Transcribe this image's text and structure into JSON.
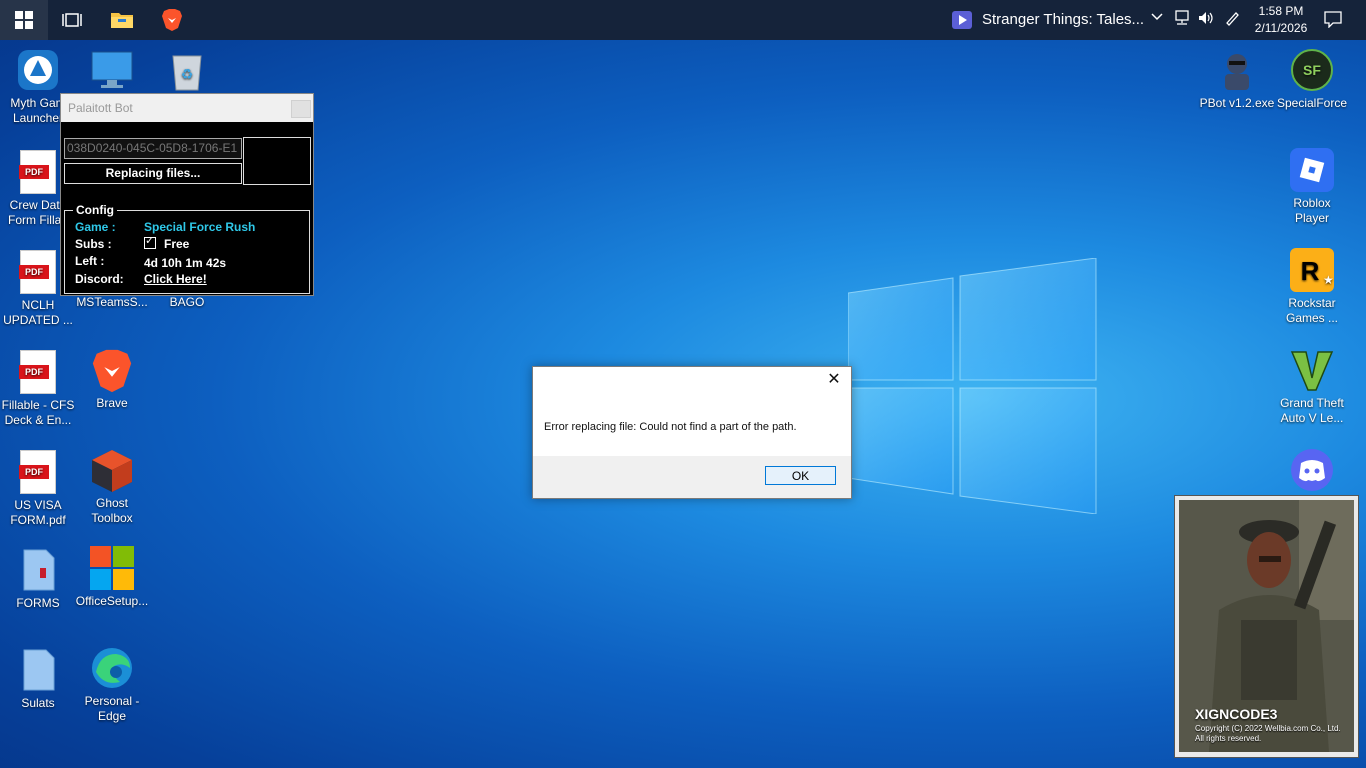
{
  "taskbar": {
    "media_title": "Stranger Things: Tales...",
    "time": "1:58 PM",
    "date": "2/11/2026",
    "icons": [
      "start-icon",
      "task-view-icon",
      "file-explorer-icon",
      "brave-icon"
    ]
  },
  "desktop_left": [
    {
      "label": "Myth Gam\nLauncher",
      "icon": "myth-launcher-icon"
    },
    {
      "label": "",
      "icon": "this-pc-icon"
    },
    {
      "label": "",
      "icon": "recycle-bin-icon"
    },
    {
      "label": "Crew Data\nForm Fillab",
      "icon": "pdf-icon"
    },
    {
      "label": "NCLH\nUPDATED ...",
      "icon": "pdf-icon"
    },
    {
      "label": "MSTeamsS...",
      "icon": "msteams-icon"
    },
    {
      "label": "BAGO",
      "icon": "folder-icon"
    },
    {
      "label": "Fillable - CFS\nDeck & En...",
      "icon": "pdf-icon"
    },
    {
      "label": "Brave",
      "icon": "brave-icon"
    },
    {
      "label": "US VISA\nFORM.pdf",
      "icon": "pdf-icon"
    },
    {
      "label": "Ghost\nToolbox",
      "icon": "ghost-toolbox-icon"
    },
    {
      "label": "FORMS",
      "icon": "document-icon"
    },
    {
      "label": "OfficeSetup...",
      "icon": "office-icon"
    },
    {
      "label": "Sulats",
      "icon": "document-icon"
    },
    {
      "label": "Personal -\nEdge",
      "icon": "edge-icon"
    }
  ],
  "desktop_right": [
    {
      "label": "PBot v1.2.exe",
      "icon": "pbot-icon"
    },
    {
      "label": "SpecialForce",
      "icon": "specialforce-icon"
    },
    {
      "label": "Roblox\nPlayer",
      "icon": "roblox-icon"
    },
    {
      "label": "Rockstar\nGames ...",
      "icon": "rockstar-icon"
    },
    {
      "label": "Grand Theft\nAuto V Le...",
      "icon": "gta-icon"
    },
    {
      "label": "",
      "icon": "discord-icon"
    }
  ],
  "bot": {
    "title": "Palaitott Bot",
    "hwid": "038D0240-045C-05D8-1706-E1",
    "status": "Replacing files...",
    "config_legend": "Config",
    "game_label": "Game :",
    "game_value": "Special Force Rush",
    "subs_label": "Subs :",
    "subs_value": "Free",
    "left_label": "Left :",
    "left_value": "4d 10h 1m 42s",
    "discord_label": "Discord:",
    "discord_value": "Click Here!"
  },
  "dialog": {
    "message": "Error replacing file: Could not find a part of the path.",
    "ok_label": "OK"
  },
  "xigncode": {
    "brand": "XIGNCODE3",
    "copyright": "Copyright (C) 2022 Wellbia.com Co., Ltd. All rights reserved."
  }
}
